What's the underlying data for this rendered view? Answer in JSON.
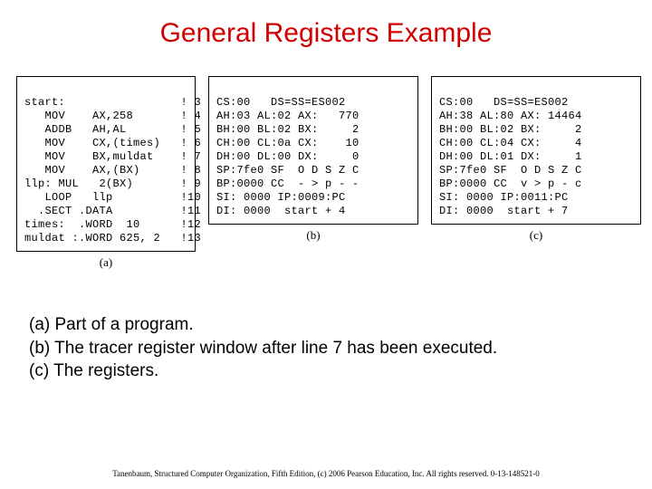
{
  "title": "General Registers Example",
  "panels": {
    "a": {
      "caption": "(a)",
      "lines": [
        "start:                 ! 3",
        "   MOV    AX,258       ! 4",
        "   ADDB   AH,AL        ! 5",
        "   MOV    CX,(times)   ! 6",
        "   MOV    BX,muldat    ! 7",
        "   MOV    AX,(BX)      ! 8",
        "llp: MUL   2(BX)       ! 9",
        "   LOOP   llp          !10",
        "  .SECT .DATA          !11",
        "times:  .WORD  10      !12",
        "muldat :.WORD 625, 2   !13"
      ]
    },
    "b": {
      "caption": "(b)",
      "lines": [
        "CS:00   DS=SS=ES002",
        "AH:03 AL:02 AX:   770",
        "BH:00 BL:02 BX:     2",
        "CH:00 CL:0a CX:    10",
        "DH:00 DL:00 DX:     0",
        "SP:7fe0 SF  O D S Z C",
        "BP:0000 CC  - > p - -",
        "SI: 0000 IP:0009:PC",
        "DI: 0000  start + 4"
      ]
    },
    "c": {
      "caption": "(c)",
      "lines": [
        "CS:00   DS=SS=ES002",
        "AH:38 AL:80 AX: 14464",
        "BH:00 BL:02 BX:     2",
        "CH:00 CL:04 CX:     4",
        "DH:00 DL:01 DX:     1",
        "SP:7fe0 SF  O D S Z C",
        "BP:0000 CC  v > p - c",
        "SI: 0000 IP:0011:PC",
        "DI: 0000  start + 7"
      ]
    }
  },
  "notes": [
    "(a) Part of a program.",
    "(b) The tracer register window after line 7 has been executed.",
    "(c) The registers."
  ],
  "footer": "Tanenbaum, Structured Computer Organization, Fifth Edition, (c) 2006 Pearson Education, Inc. All rights reserved. 0-13-148521-0"
}
